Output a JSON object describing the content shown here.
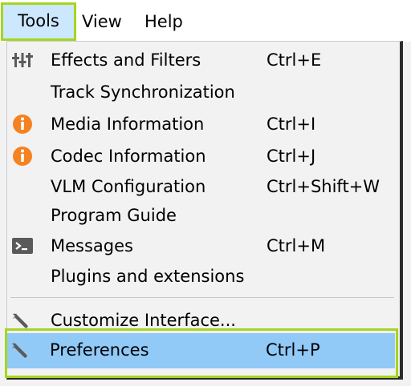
{
  "menubar": {
    "tools": "Tools",
    "view": "View",
    "help": "Help"
  },
  "menu": {
    "items": [
      {
        "label": "Effects and Filters",
        "shortcut": "Ctrl+E",
        "icon": "sliders-icon"
      },
      {
        "label": "Track Synchronization",
        "shortcut": "",
        "icon": ""
      },
      {
        "label": "Media Information",
        "shortcut": "Ctrl+I",
        "icon": "info-icon"
      },
      {
        "label": "Codec Information",
        "shortcut": "Ctrl+J",
        "icon": "info-icon"
      },
      {
        "label": "VLM Configuration",
        "shortcut": "Ctrl+Shift+W",
        "icon": ""
      },
      {
        "label": "Program Guide",
        "shortcut": "",
        "icon": ""
      },
      {
        "label": "Messages",
        "shortcut": "Ctrl+M",
        "icon": "terminal-icon"
      },
      {
        "label": "Plugins and extensions",
        "shortcut": "",
        "icon": ""
      },
      {
        "label": "Customize Interface...",
        "shortcut": "",
        "icon": "wrench-icon"
      },
      {
        "label": "Preferences",
        "shortcut": "Ctrl+P",
        "icon": "wrench-icon",
        "selected": true
      }
    ]
  },
  "colors": {
    "info_orange": "#f58220",
    "highlight_blue": "#91c9f7",
    "focus_green": "#a6d51f",
    "icon_gray": "#5a5a5a"
  }
}
